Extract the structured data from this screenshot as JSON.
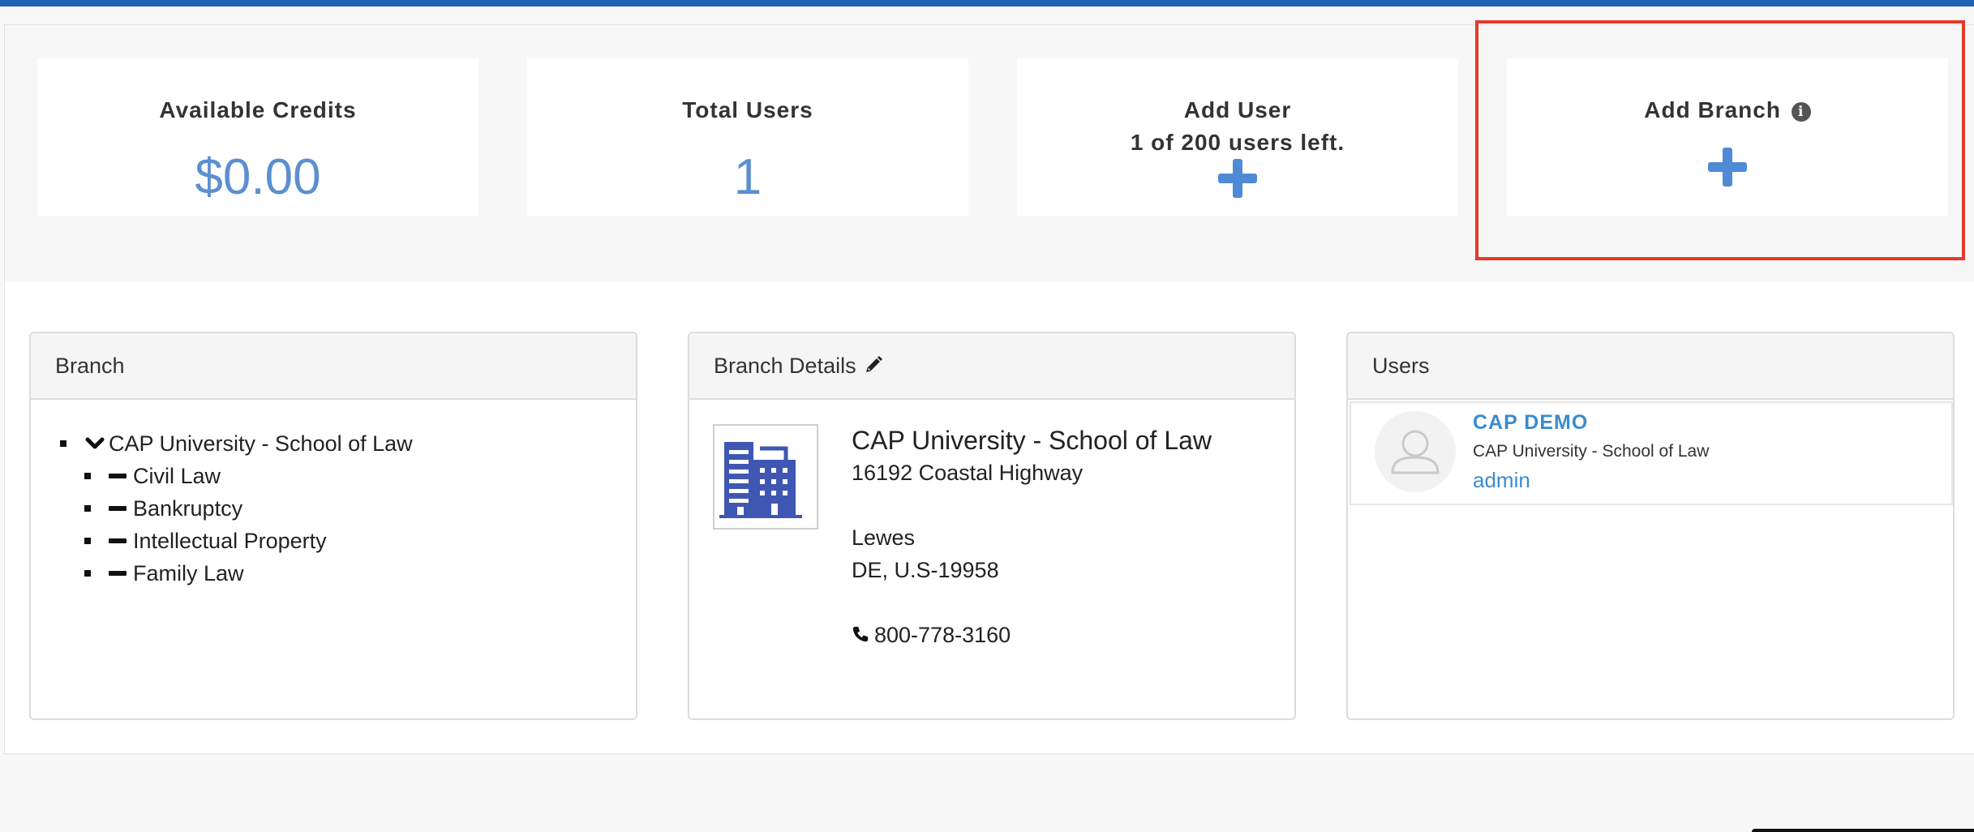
{
  "stats": {
    "credits": {
      "title": "Available Credits",
      "value": "$0.00"
    },
    "users": {
      "title": "Total Users",
      "value": "1"
    },
    "add_user": {
      "title": "Add User",
      "subtitle": "1 of 200 users left.",
      "icon": "plus-icon"
    },
    "add_branch": {
      "title": "Add Branch",
      "info_icon": "info-icon",
      "info_glyph": "i",
      "icon": "plus-icon"
    }
  },
  "branch_panel": {
    "title": "Branch",
    "root": "CAP University - School of Law",
    "children": [
      "Civil Law",
      "Bankruptcy",
      "Intellectual Property",
      "Family Law"
    ]
  },
  "details_panel": {
    "title": "Branch Details",
    "edit_icon": "pencil-icon",
    "name": "CAP University - School of Law",
    "address": "16192 Coastal Highway",
    "city": "Lewes",
    "state_zip": "DE, U.S-19958",
    "phone": "800-778-3160"
  },
  "users_panel": {
    "title": "Users",
    "users": [
      {
        "name": "CAP DEMO",
        "org": "CAP University - School of Law",
        "role": "admin"
      }
    ]
  },
  "colors": {
    "accent": "#1e65b7",
    "stat_value": "#5b8fd1",
    "link": "#3b8ccc",
    "highlight": "#e53a2b"
  }
}
